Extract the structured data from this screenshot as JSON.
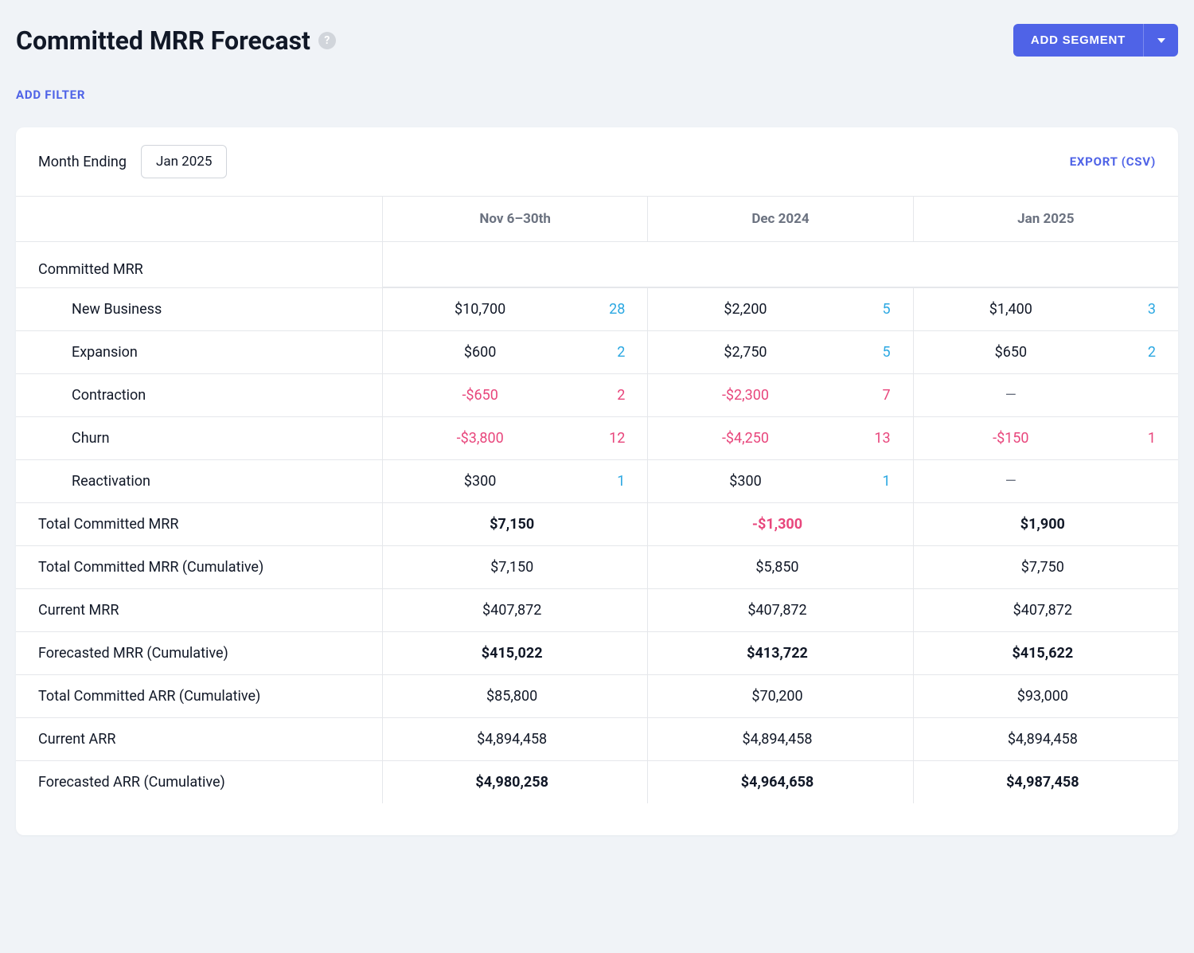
{
  "header": {
    "title": "Committed MRR Forecast",
    "add_segment_label": "ADD SEGMENT"
  },
  "filters": {
    "add_filter_label": "ADD FILTER"
  },
  "card": {
    "month_ending_label": "Month Ending",
    "month_ending_value": "Jan 2025",
    "export_label": "EXPORT (CSV)"
  },
  "columns": [
    "Nov 6–30th",
    "Dec 2024",
    "Jan 2025"
  ],
  "section_label": "Committed MRR",
  "rows": {
    "new_business": {
      "label": "New Business",
      "cols": [
        {
          "value": "$10,700",
          "count": "28"
        },
        {
          "value": "$2,200",
          "count": "5"
        },
        {
          "value": "$1,400",
          "count": "3"
        }
      ]
    },
    "expansion": {
      "label": "Expansion",
      "cols": [
        {
          "value": "$600",
          "count": "2"
        },
        {
          "value": "$2,750",
          "count": "5"
        },
        {
          "value": "$650",
          "count": "2"
        }
      ]
    },
    "contraction": {
      "label": "Contraction",
      "cols": [
        {
          "value": "-$650",
          "count": "2"
        },
        {
          "value": "-$2,300",
          "count": "7"
        },
        {
          "value": "—",
          "count": ""
        }
      ]
    },
    "churn": {
      "label": "Churn",
      "cols": [
        {
          "value": "-$3,800",
          "count": "12"
        },
        {
          "value": "-$4,250",
          "count": "13"
        },
        {
          "value": "-$150",
          "count": "1"
        }
      ]
    },
    "reactivation": {
      "label": "Reactivation",
      "cols": [
        {
          "value": "$300",
          "count": "1"
        },
        {
          "value": "$300",
          "count": "1"
        },
        {
          "value": "—",
          "count": ""
        }
      ]
    }
  },
  "summary": {
    "total_committed_mrr": {
      "label": "Total Committed MRR",
      "cols": [
        "$7,150",
        "-$1,300",
        "$1,900"
      ],
      "neg_flags": [
        false,
        true,
        false
      ]
    },
    "total_committed_mrr_cum": {
      "label": "Total Committed MRR (Cumulative)",
      "cols": [
        "$7,150",
        "$5,850",
        "$7,750"
      ]
    },
    "current_mrr": {
      "label": "Current MRR",
      "cols": [
        "$407,872",
        "$407,872",
        "$407,872"
      ]
    },
    "forecasted_mrr_cum": {
      "label": "Forecasted MRR (Cumulative)",
      "cols": [
        "$415,022",
        "$413,722",
        "$415,622"
      ]
    },
    "total_committed_arr_cum": {
      "label": "Total Committed ARR (Cumulative)",
      "cols": [
        "$85,800",
        "$70,200",
        "$93,000"
      ]
    },
    "current_arr": {
      "label": "Current ARR",
      "cols": [
        "$4,894,458",
        "$4,894,458",
        "$4,894,458"
      ]
    },
    "forecasted_arr_cum": {
      "label": "Forecasted ARR (Cumulative)",
      "cols": [
        "$4,980,258",
        "$4,964,658",
        "$4,987,458"
      ]
    }
  }
}
